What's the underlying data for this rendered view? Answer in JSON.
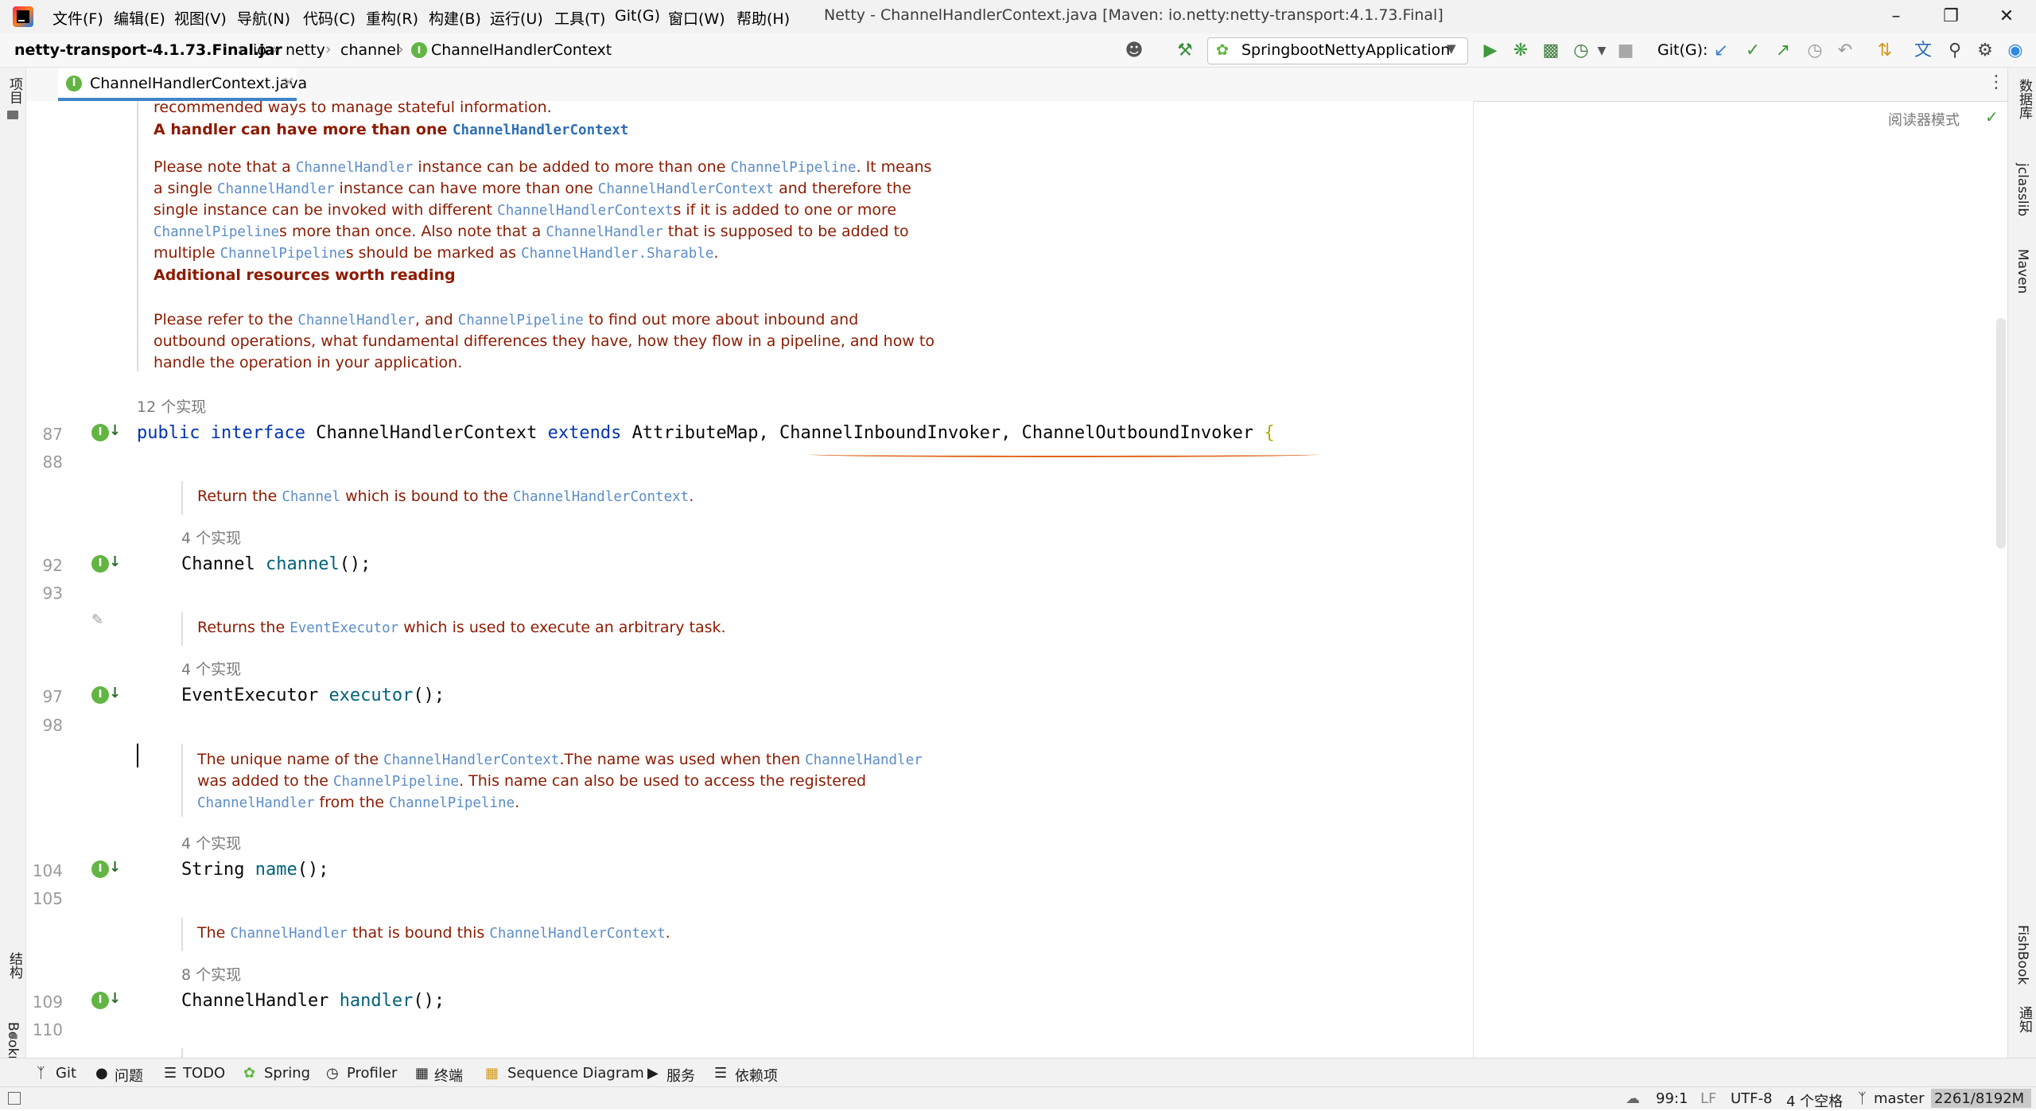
{
  "window": {
    "title": "Netty - ChannelHandlerContext.java [Maven: io.netty:netty-transport:4.1.73.Final]",
    "menu": [
      "文件(F)",
      "编辑(E)",
      "视图(V)",
      "导航(N)",
      "代码(C)",
      "重构(R)",
      "构建(B)",
      "运行(U)",
      "工具(T)",
      "Git(G)",
      "窗口(W)",
      "帮助(H)"
    ]
  },
  "breadcrumb": {
    "root": "netty-transport-4.1.73.Final.jar",
    "parts": [
      "io",
      "netty",
      "channel"
    ],
    "current": "ChannelHandlerContext"
  },
  "toolbar": {
    "run_config": "SpringbootNettyApplication",
    "git_label": "Git(G):"
  },
  "tab": {
    "label": "ChannelHandlerContext.java"
  },
  "editor": {
    "reader_mode": "阅读器模式",
    "doc_top": {
      "line1": "recommended ways to manage stateful information.",
      "heading1_text": "A handler can have more than one ",
      "heading1_code": "ChannelHandlerContext",
      "p1_l1_a": "Please note that a ",
      "p1_l1_b": "ChannelHandler",
      "p1_l1_c": " instance can be added to more than one ",
      "p1_l1_d": "ChannelPipeline",
      "p1_l1_e": ". It means",
      "p1_l2_a": "a single ",
      "p1_l2_b": "ChannelHandler",
      "p1_l2_c": " instance can have more than one ",
      "p1_l2_d": "ChannelHandlerContext",
      "p1_l2_e": " and therefore the",
      "p1_l3_a": "single instance can be invoked with different ",
      "p1_l3_b": "ChannelHandlerContext",
      "p1_l3_c": "s if it is added to one or more",
      "p1_l4_a": "ChannelPipeline",
      "p1_l4_b": "s more than once. Also note that a ",
      "p1_l4_c": "ChannelHandler",
      "p1_l4_d": " that is supposed to be added to",
      "p1_l5_a": "multiple ",
      "p1_l5_b": "ChannelPipeline",
      "p1_l5_c": "s should be marked as ",
      "p1_l5_d": "ChannelHandler.Sharable",
      "p1_l5_e": ".",
      "heading2": "Additional resources worth reading",
      "p2_l1_a": "Please refer to the ",
      "p2_l1_b": "ChannelHandler",
      "p2_l1_c": ", and ",
      "p2_l1_d": "ChannelPipeline",
      "p2_l1_e": " to find out more about inbound and",
      "p2_l2": "outbound operations, what fundamental differences they have, how they flow in a pipeline, and how to",
      "p2_l3": "handle the operation in your application."
    },
    "impl_12": "12 个实现",
    "interface_line": {
      "kw1": "public",
      "kw2": "interface",
      "name": "ChannelHandlerContext",
      "kw3": "extends",
      "t1": "AttributeMap,",
      "t2": "ChannelInboundInvoker,",
      "t3": "ChannelOutboundInvoker",
      "brace": "{"
    },
    "m1": {
      "doc_a": "Return the ",
      "doc_b": "Channel",
      "doc_c": " which is bound to the ",
      "doc_d": "ChannelHandlerContext",
      "doc_e": ".",
      "impl": "4 个实现",
      "type": "Channel",
      "name": "channel",
      "tail": "();"
    },
    "m2": {
      "doc_a": "Returns the ",
      "doc_b": "EventExecutor",
      "doc_c": " which is used to execute an arbitrary task.",
      "impl": "4 个实现",
      "type": "EventExecutor",
      "name": "executor",
      "tail": "();"
    },
    "m3": {
      "l1_a": "The unique name of the ",
      "l1_b": "ChannelHandlerContext",
      "l1_c": ".The name was used when then ",
      "l1_d": "ChannelHandler",
      "l2_a": "was added to the ",
      "l2_b": "ChannelPipeline",
      "l2_c": ". This name can also be used to access the registered",
      "l3_a": "ChannelHandler",
      "l3_b": " from the ",
      "l3_c": "ChannelPipeline",
      "l3_d": ".",
      "impl": "4 个实现",
      "type": "String",
      "name": "name",
      "tail": "();"
    },
    "m4": {
      "doc_a": "The ",
      "doc_b": "ChannelHandler",
      "doc_c": " that is bound this ",
      "doc_d": "ChannelHandlerContext",
      "doc_e": ".",
      "impl": "8 个实现",
      "type": "ChannelHandler",
      "name": "handler",
      "tail": "();"
    },
    "line_numbers": [
      "87",
      "88",
      "92",
      "93",
      "97",
      "98",
      "104",
      "105",
      "109",
      "110"
    ]
  },
  "left_strip": {
    "project": "项目",
    "structure": "结构",
    "bookmarks": "Bookmarks"
  },
  "right_strip": {
    "database": "数据库",
    "jclasslib": "jclasslib",
    "maven": "Maven",
    "fishbook": "FishBook",
    "notifications": "通知"
  },
  "bottom_tools": [
    "Git",
    "问题",
    "TODO",
    "Spring",
    "Profiler",
    "终端",
    "Sequence Diagram",
    "服务",
    "依赖项"
  ],
  "status": {
    "position": "99:1",
    "line_sep": "LF",
    "encoding": "UTF-8",
    "indent": "4 个空格",
    "branch": "master",
    "memory": "2261/8192M"
  },
  "colors": {
    "doc_text": "#8c1a00",
    "doc_code": "#5b8dc9",
    "keyword": "#0033b3",
    "method": "#00627a",
    "impl_badge": "#62b543",
    "tab_underline": "#4083c9"
  }
}
